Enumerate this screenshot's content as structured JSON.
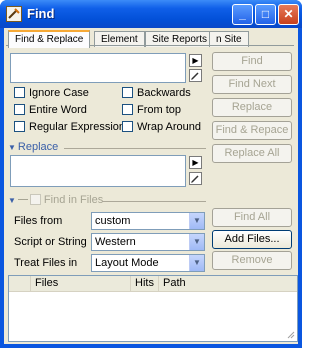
{
  "window": {
    "title": "Find"
  },
  "titlebar_buttons": {
    "minimize": "_",
    "maximize": "□",
    "close": "✕"
  },
  "tabs": [
    {
      "label": "Find & Replace",
      "active": true
    },
    {
      "label": "Element",
      "active": false
    },
    {
      "label": "Site Reports",
      "active": false
    },
    {
      "label": "n Site",
      "active": false
    }
  ],
  "find": {
    "text_value": "",
    "options": [
      {
        "label": "Ignore Case",
        "checked": false
      },
      {
        "label": "Backwards",
        "checked": false
      },
      {
        "label": "Entire Word",
        "checked": false
      },
      {
        "label": "From top",
        "checked": false
      },
      {
        "label": "Regular Expression",
        "checked": false
      },
      {
        "label": "Wrap Around",
        "checked": false
      }
    ]
  },
  "buttons": {
    "find": "Find",
    "find_next": "Find Next",
    "replace": "Replace",
    "find_and_replace": "Find & Repace",
    "replace_all": "Replace All",
    "find_all": "Find All",
    "add_files": "Add Files...",
    "remove": "Remove"
  },
  "replace_section": {
    "label": "Replace",
    "text_value": ""
  },
  "find_in_files": {
    "label": "Find in Files",
    "checked": false,
    "files_from": {
      "label": "Files from",
      "value": "custom"
    },
    "script_or_string": {
      "label": "Script or String",
      "value": "Western"
    },
    "treat_files_in": {
      "label": "Treat Files in",
      "value": "Layout Mode"
    }
  },
  "results_table": {
    "columns": [
      "Files",
      "Hits",
      "Path"
    ],
    "rows": []
  }
}
